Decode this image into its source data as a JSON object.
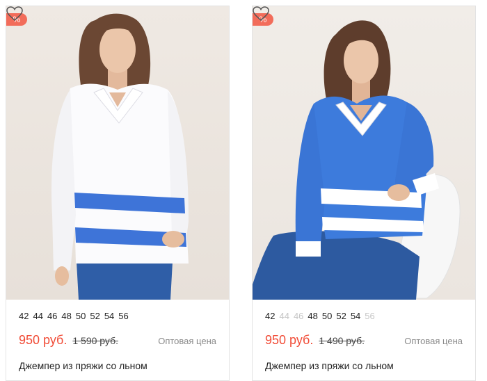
{
  "products": [
    {
      "badge": "%",
      "sizes": [
        {
          "label": "42",
          "available": true
        },
        {
          "label": "44",
          "available": true
        },
        {
          "label": "46",
          "available": true
        },
        {
          "label": "48",
          "available": true
        },
        {
          "label": "50",
          "available": true
        },
        {
          "label": "52",
          "available": true
        },
        {
          "label": "54",
          "available": true
        },
        {
          "label": "56",
          "available": true
        }
      ],
      "price": "950 руб.",
      "old_price": "1 590 руб.",
      "wholesale_label": "Оптовая цена",
      "title": "Джемпер из пряжи со льном",
      "favorite_icon": "heart-icon",
      "colors": {
        "sweater": "#fbfbfd",
        "stripe": "#3e74d8",
        "jeans": "#2f5ea7",
        "hair": "#6b4733",
        "skin": "#e8c1a4"
      }
    },
    {
      "badge": "%",
      "sizes": [
        {
          "label": "42",
          "available": true
        },
        {
          "label": "44",
          "available": false
        },
        {
          "label": "46",
          "available": false
        },
        {
          "label": "48",
          "available": true
        },
        {
          "label": "50",
          "available": true
        },
        {
          "label": "52",
          "available": true
        },
        {
          "label": "54",
          "available": true
        },
        {
          "label": "56",
          "available": false
        }
      ],
      "price": "950 руб.",
      "old_price": "1 490 руб.",
      "wholesale_label": "Оптовая цена",
      "title": "Джемпер из пряжи со льном",
      "favorite_icon": "heart-icon",
      "colors": {
        "sweater": "#3d7bdc",
        "stripe": "#ffffff",
        "jeans": "#2d5aa0",
        "hair": "#5e3d2c",
        "skin": "#e6bd9e"
      }
    }
  ]
}
